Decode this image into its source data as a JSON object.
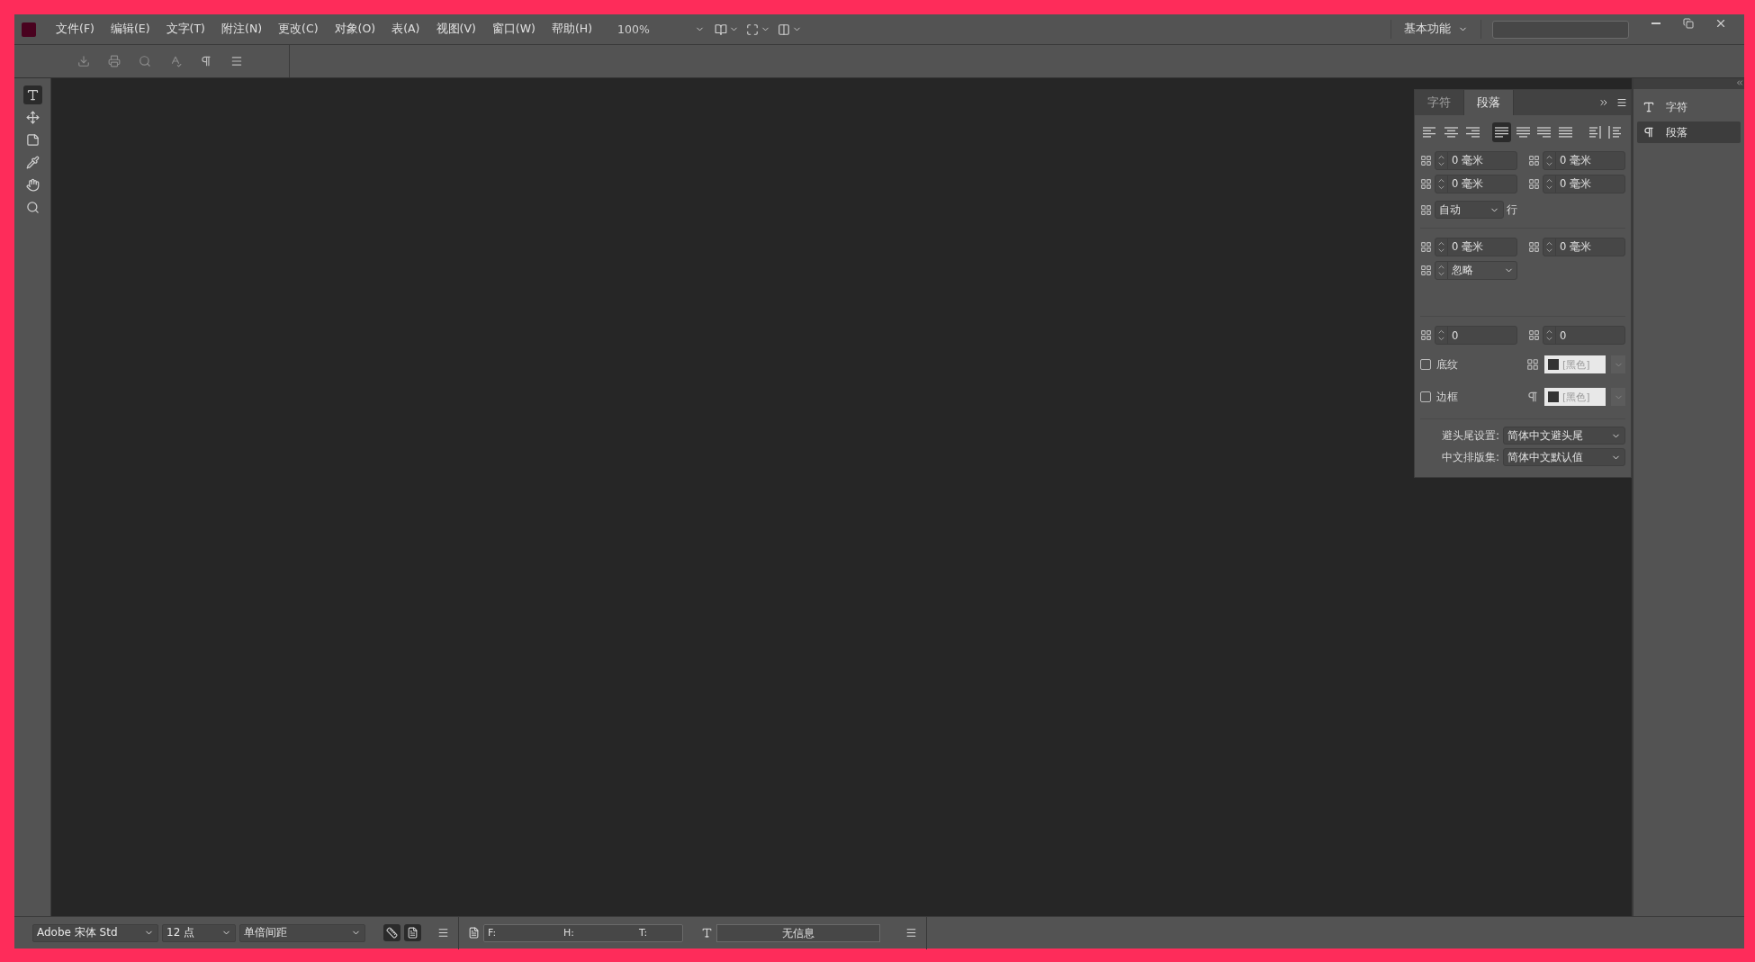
{
  "menu_bar": {
    "items": [
      "文件(F)",
      "编辑(E)",
      "文字(T)",
      "附注(N)",
      "更改(C)",
      "对象(O)",
      "表(A)",
      "视图(V)",
      "窗口(W)",
      "帮助(H)"
    ],
    "zoom": "100%",
    "workspace": "基本功能"
  },
  "tools": [
    {
      "kind": "type",
      "selected": true
    },
    {
      "kind": "position",
      "selected": false
    },
    {
      "kind": "note",
      "selected": false
    },
    {
      "kind": "eyedropper",
      "selected": false
    },
    {
      "kind": "hand",
      "selected": false
    },
    {
      "kind": "zoom",
      "selected": false
    }
  ],
  "paragraph_panel": {
    "tabs": [
      {
        "label": "字符",
        "selected": false
      },
      {
        "label": "段落",
        "selected": true
      }
    ],
    "alignments": [
      {
        "kind": "left",
        "selected": false
      },
      {
        "kind": "center",
        "selected": false
      },
      {
        "kind": "right",
        "selected": false
      },
      {
        "kind": "justify-left",
        "selected": true
      },
      {
        "kind": "justify-center",
        "selected": false
      },
      {
        "kind": "justify-right",
        "selected": false
      },
      {
        "kind": "justify-all",
        "selected": false
      },
      {
        "kind": "toward-spine",
        "selected": false
      },
      {
        "kind": "away-spine",
        "selected": false
      }
    ],
    "indents": [
      "0 毫米",
      "0 毫米",
      "0 毫米",
      "0 毫米"
    ],
    "grid_align": {
      "value": "自动",
      "unit": "行"
    },
    "drop_cap": [
      "0 毫米",
      "0 毫米"
    ],
    "drop_cap_mode": "忽略",
    "spacing": [
      "0",
      "0"
    ],
    "options": [
      {
        "kind": "shading",
        "label": "底纹",
        "checked": false,
        "swatch": "[黑色]"
      },
      {
        "kind": "border",
        "label": "边框",
        "checked": false,
        "swatch": "[黑色]"
      }
    ],
    "settings": [
      {
        "label": "避头尾设置:",
        "value": "简体中文避头尾"
      },
      {
        "label": "中文排版集:",
        "value": "简体中文默认值"
      }
    ]
  },
  "dock": [
    {
      "kind": "character",
      "label": "字符",
      "selected": false
    },
    {
      "kind": "paragraph",
      "label": "段落",
      "selected": true
    }
  ],
  "status_bar": {
    "font": "Adobe 宋体 Std",
    "size": "12 点",
    "leading": "单倍间距",
    "toggles": [
      {
        "kind": "line-numbers",
        "selected": true
      },
      {
        "kind": "page-view",
        "selected": true
      }
    ],
    "fields": [
      "F:",
      "H:",
      "T:"
    ],
    "info": "无信息"
  }
}
